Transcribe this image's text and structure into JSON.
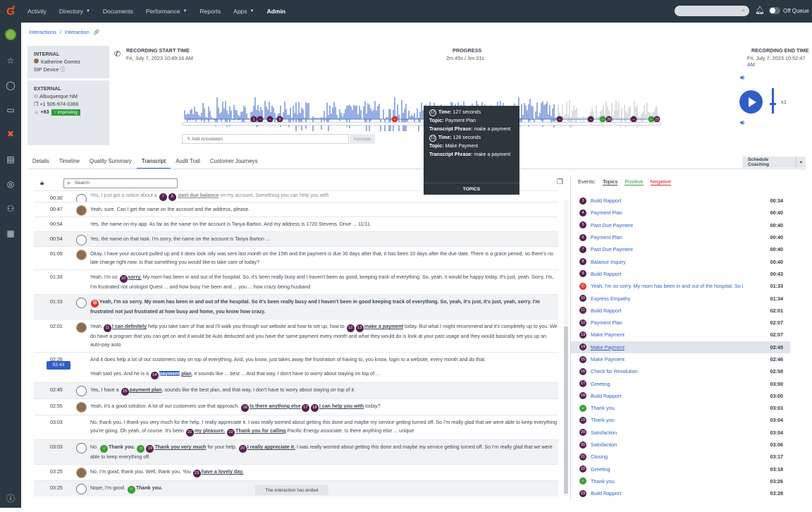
{
  "topnav": {
    "items": [
      {
        "label": "Activity",
        "dropdown": false
      },
      {
        "label": "Directory",
        "dropdown": true
      },
      {
        "label": "Documents",
        "dropdown": false
      },
      {
        "label": "Performance",
        "dropdown": true
      },
      {
        "label": "Reports",
        "dropdown": false
      },
      {
        "label": "Apps",
        "dropdown": true
      },
      {
        "label": "Admin",
        "dropdown": false
      }
    ],
    "status_label": "Off Queue"
  },
  "breadcrumb": {
    "root": "Interactions",
    "current": "Interaction"
  },
  "internal": {
    "heading": "INTERNAL",
    "name": "Katherine Gomez",
    "device": "SIP Device"
  },
  "external": {
    "heading": "EXTERNAL",
    "location": "Albuquerque NM",
    "phone": "+1 505-974-0366",
    "score": "+93",
    "sentiment": "improving"
  },
  "recording": {
    "start_label": "RECORDING START TIME",
    "start_value": "Fri, July 7, 2023 10:49:16 AM",
    "progress_label": "PROGRESS",
    "progress_value": "2m 45s / 3m 31s",
    "end_label": "RECORDING END TIME",
    "end_value": "Fri, July 7, 2023 10:52:47 AM",
    "progress_fraction": 0.782,
    "speed": "x1"
  },
  "annotation": {
    "placeholder": "Add Annotation",
    "button": "Annotate"
  },
  "tooltip": {
    "items": [
      {
        "num": "12",
        "time": "127 seconds",
        "topic": "Payment Plan",
        "phrase": "make a payment"
      },
      {
        "num": "13",
        "time": "128 seconds",
        "topic": "Make Payment",
        "phrase": "make a payment"
      }
    ],
    "labels": {
      "time": "Time:",
      "topic": "Topic:",
      "phrase": "Transcript Phrase:"
    },
    "footer": "TOPICS"
  },
  "tabs": [
    "Details",
    "Timeline",
    "Quality Summary",
    "Transcript",
    "Audit Trail",
    "Customer Journeys"
  ],
  "active_tab": "Transcript",
  "schedule_coaching": "Schedule Coaching",
  "transcript": {
    "search_placeholder": "Search",
    "current_time": "02:43",
    "ended": "The interaction has ended"
  },
  "events": {
    "title": "Events:",
    "filters": {
      "topics": "Topics",
      "positive": "Positive",
      "negative": "Negative"
    },
    "items": [
      {
        "n": "3",
        "label": "Build Rapport",
        "time": "00:34",
        "kind": "topic"
      },
      {
        "n": "4",
        "label": "Payment Plan",
        "time": "00:40",
        "kind": "topic"
      },
      {
        "n": "5",
        "label": "Past Due Payment",
        "time": "00:40",
        "kind": "topic"
      },
      {
        "n": "6",
        "label": "Payment Plan",
        "time": "00:40",
        "kind": "topic"
      },
      {
        "n": "7",
        "label": "Past Due Payment",
        "time": "00:40",
        "kind": "topic"
      },
      {
        "n": "8",
        "label": "Balance Inquiry",
        "time": "00:40",
        "kind": "topic"
      },
      {
        "n": "9",
        "label": "Build Rapport",
        "time": "00:43",
        "kind": "topic"
      },
      {
        "n": "",
        "label": "Yeah, I'm so sorry. My mom has been in and out of the hospital. So i",
        "time": "01:33",
        "kind": "negative"
      },
      {
        "n": "10",
        "label": "Express Empathy",
        "time": "01:34",
        "kind": "topic"
      },
      {
        "n": "11",
        "label": "Build Rapport",
        "time": "02:01",
        "kind": "topic"
      },
      {
        "n": "12",
        "label": "Payment Plan",
        "time": "02:07",
        "kind": "topic"
      },
      {
        "n": "13",
        "label": "Make Payment",
        "time": "02:07",
        "kind": "topic"
      },
      {
        "n": "14",
        "label": "Make Payment",
        "time": "02:45",
        "kind": "topic",
        "selected": true
      },
      {
        "n": "15",
        "label": "Make Payment",
        "time": "02:46",
        "kind": "topic"
      },
      {
        "n": "16",
        "label": "Check for Resolution",
        "time": "02:58",
        "kind": "topic"
      },
      {
        "n": "17",
        "label": "Greeting",
        "time": "03:00",
        "kind": "topic"
      },
      {
        "n": "18",
        "label": "Build Rapport",
        "time": "03:00",
        "kind": "topic"
      },
      {
        "n": "",
        "label": "Thank you.",
        "time": "03:03",
        "kind": "positive"
      },
      {
        "n": "19",
        "label": "Thank you",
        "time": "03:04",
        "kind": "topic"
      },
      {
        "n": "20",
        "label": "Satisfaction",
        "time": "03:04",
        "kind": "topic"
      },
      {
        "n": "20",
        "label": "Satisfaction",
        "time": "03:06",
        "kind": "topic"
      },
      {
        "n": "21",
        "label": "Closing",
        "time": "03:17",
        "kind": "topic"
      },
      {
        "n": "22",
        "label": "Greeting",
        "time": "03:18",
        "kind": "topic"
      },
      {
        "n": "",
        "label": "Thank you.",
        "time": "03:26",
        "kind": "positive"
      },
      {
        "n": "23",
        "label": "Build Rapport",
        "time": "03:28",
        "kind": "topic"
      }
    ]
  }
}
